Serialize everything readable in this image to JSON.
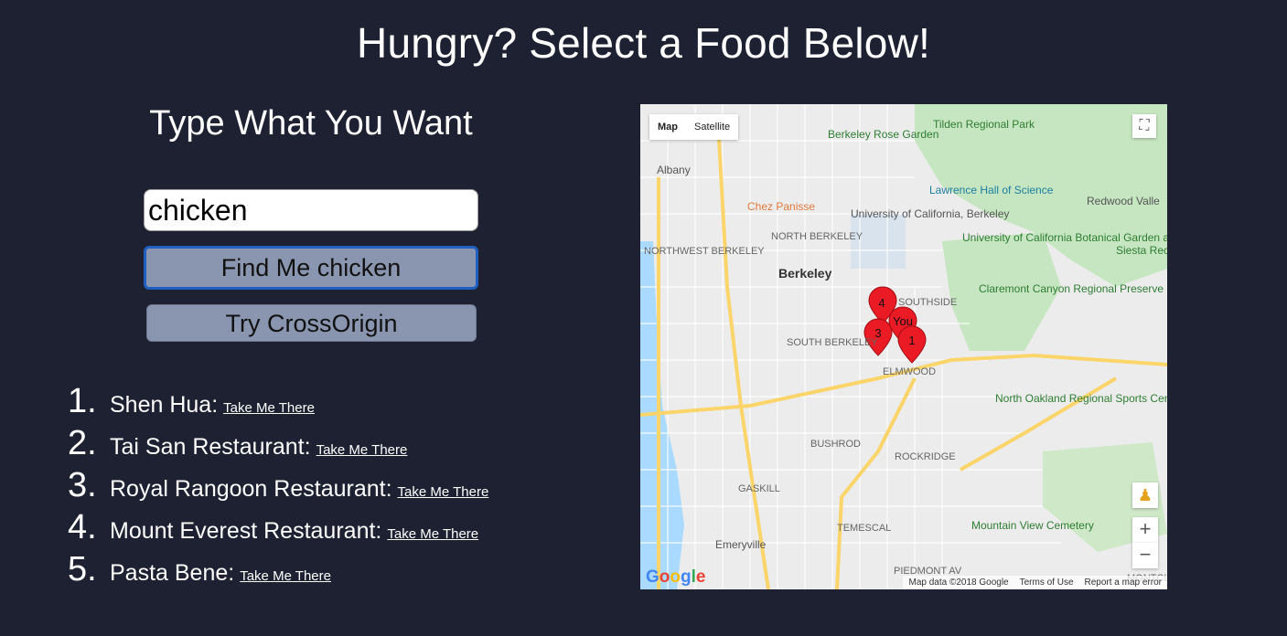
{
  "page": {
    "title": "Hungry? Select a Food Below!"
  },
  "search": {
    "heading": "Type What You Want",
    "value": "chicken",
    "find_button": "Find Me chicken",
    "cors_button": "Try CrossOrigin"
  },
  "results": [
    {
      "number": "1.",
      "name": "Shen Hua:",
      "link": "Take Me There"
    },
    {
      "number": "2.",
      "name": "Tai San Restaurant:",
      "link": "Take Me There"
    },
    {
      "number": "3.",
      "name": "Royal Rangoon Restaurant:",
      "link": "Take Me There"
    },
    {
      "number": "4.",
      "name": "Mount Everest Restaurant:",
      "link": "Take Me There"
    },
    {
      "number": "5.",
      "name": "Pasta Bene:",
      "link": "Take Me There"
    }
  ],
  "map": {
    "map_type": {
      "map": "Map",
      "satellite": "Satellite"
    },
    "labels": {
      "rose_garden": "Berkeley Rose Garden",
      "tilden": "Tilden Regional Park",
      "albany": "Albany",
      "chez": "Chez Panisse",
      "uc": "University of California, Berkeley",
      "lawrence": "Lawrence Hall of Science",
      "redwood": "Redwood Valle",
      "northwest": "NORTHWEST BERKELEY",
      "north": "NORTH BERKELEY",
      "berkeley": "Berkeley",
      "southside": "SOUTHSIDE",
      "botanical": "University of California Botanical Garden at...",
      "siesta": "Siesta Recre Are",
      "claremont": "Claremont Canyon Regional Preserve",
      "south": "SOUTH BERKELEY",
      "elmwood": "ELMWOOD",
      "north_oakland": "North Oakland Regional Sports Center",
      "bushrod": "BUSHROD",
      "rockridge": "ROCKRIDGE",
      "gaskill": "GASKILL",
      "temescal": "TEMESCAL",
      "mountain_view": "Mountain View Cemetery",
      "emeryville": "Emeryville",
      "piedmont": "PIEDMONT AV",
      "montcla": "MONTCLA"
    },
    "markers": [
      "4",
      "3",
      "You",
      "1"
    ],
    "attribution": {
      "data": "Map data ©2018 Google",
      "terms": "Terms of Use",
      "report": "Report a map error"
    },
    "logo": "Google",
    "zoom_in": "+",
    "zoom_out": "−"
  }
}
